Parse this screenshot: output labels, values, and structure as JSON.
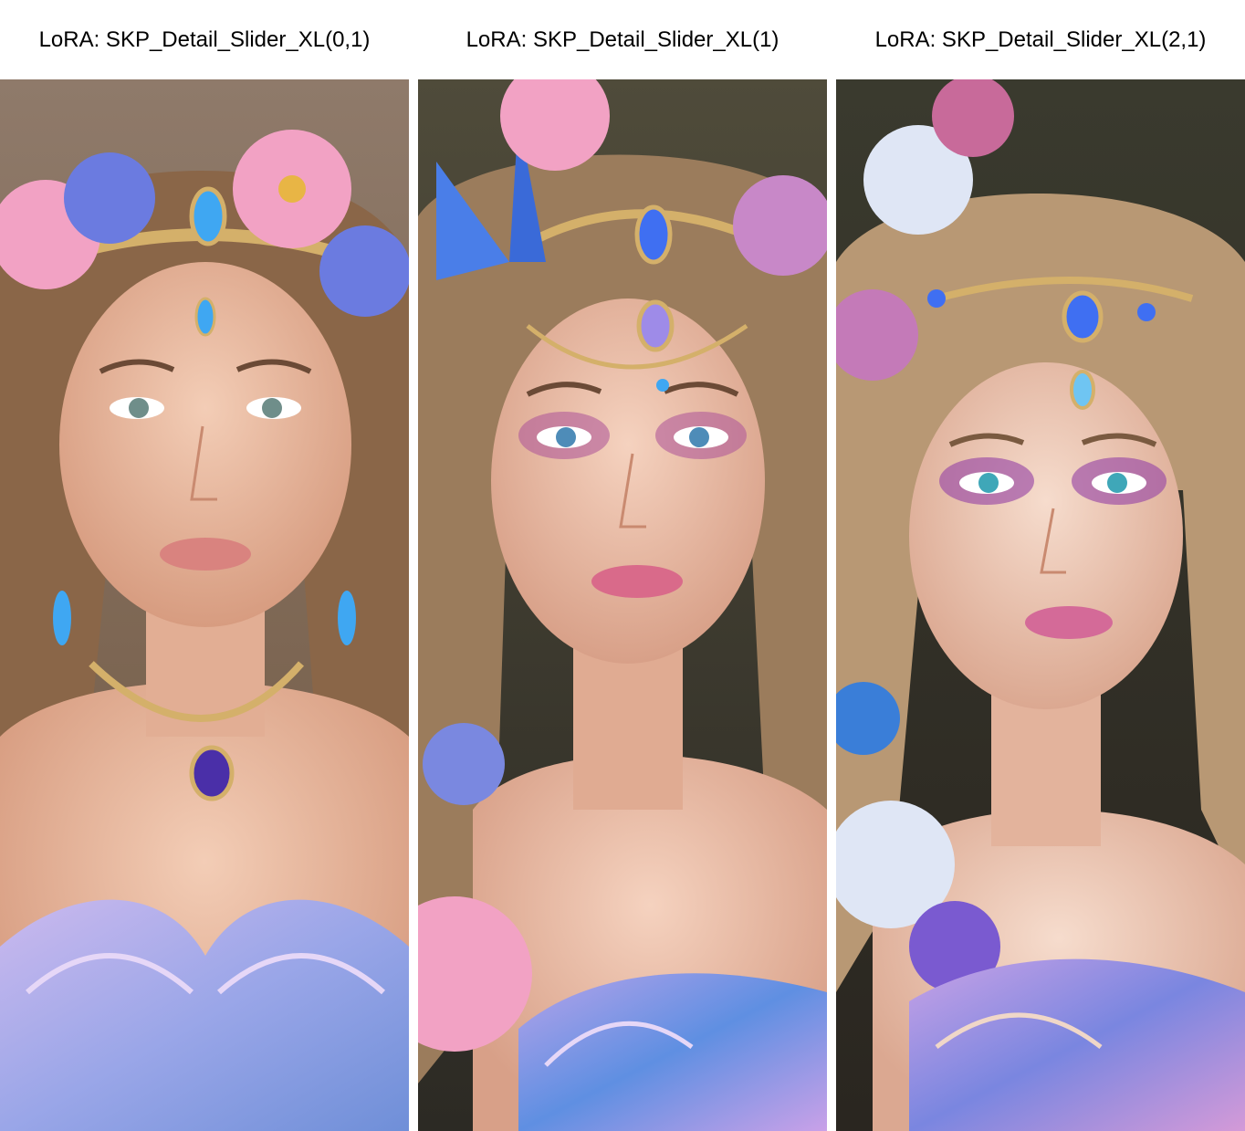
{
  "columns": [
    {
      "label": "LoRA: SKP_Detail_Slider_XL(0,1)"
    },
    {
      "label": "LoRA: SKP_Detail_Slider_XL(1)"
    },
    {
      "label": "LoRA: SKP_Detail_Slider_XL(2,1)"
    }
  ],
  "palette": {
    "background": "#ffffff",
    "skin": "#e9b9a0",
    "hair": "#8a6648",
    "flower_pink": "#f2a2c4",
    "flower_blue": "#6b7be0",
    "gold": "#d4b06a",
    "gem_blue": "#3fa7f2",
    "dress_lavender": "#b9a5e6"
  }
}
